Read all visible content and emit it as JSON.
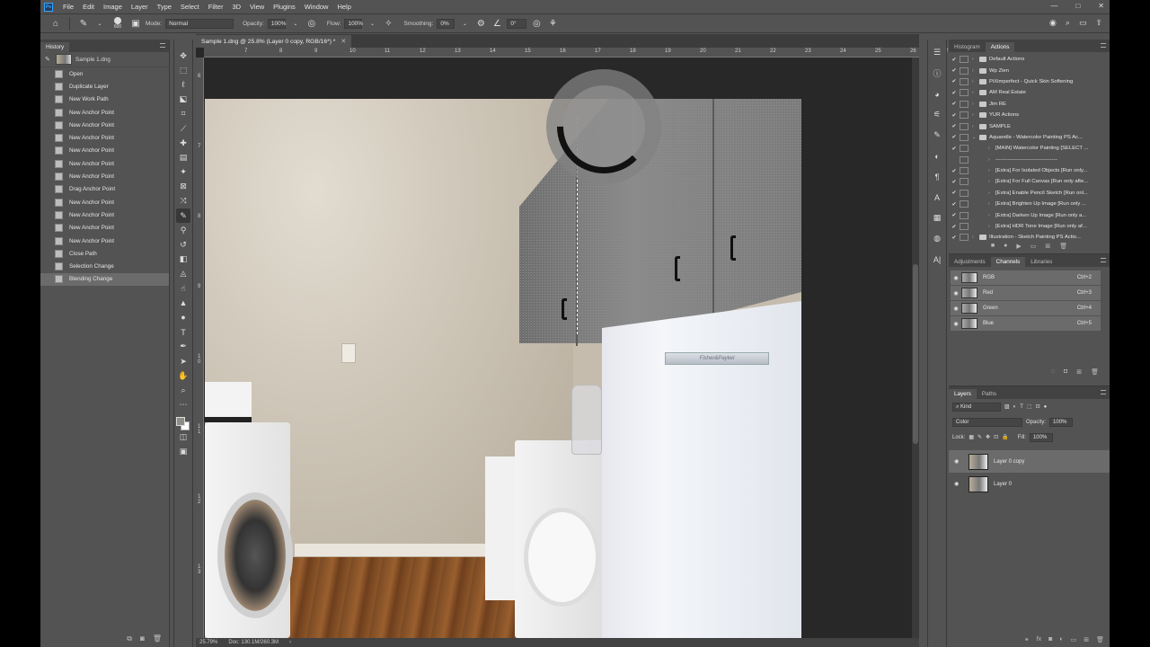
{
  "menubar": {
    "logo": "Ps",
    "items": [
      "File",
      "Edit",
      "Image",
      "Layer",
      "Type",
      "Select",
      "Filter",
      "3D",
      "View",
      "Plugins",
      "Window",
      "Help"
    ],
    "window_controls": [
      "—",
      "□",
      "✕"
    ]
  },
  "options": {
    "brush_size": "600",
    "mode_label": "Mode:",
    "mode_value": "Normal",
    "opacity_label": "Opacity:",
    "opacity_value": "100%",
    "flow_label": "Flow:",
    "flow_value": "100%",
    "smoothing_label": "Smoothing:",
    "smoothing_value": "0%",
    "angle_value": "0°"
  },
  "history": {
    "title": "History",
    "snapshot": "Sample 1.dng",
    "states": [
      "Open",
      "Duplicate Layer",
      "New Work Path",
      "New Anchor Point",
      "New Anchor Point",
      "New Anchor Point",
      "New Anchor Point",
      "New Anchor Point",
      "New Anchor Point",
      "Drag Anchor Point",
      "New Anchor Point",
      "New Anchor Point",
      "New Anchor Point",
      "New Anchor Point",
      "Close Path",
      "Selection Change",
      "Blending Change"
    ],
    "active_index": 16
  },
  "document": {
    "tab_title": "Sample 1.dng @ 25.8% (Layer 0 copy, RGB/16*) *",
    "zoom": "25.79%",
    "doc_size": "Doc: 130.1M/260.3M",
    "ruler_h": [
      "7",
      "8",
      "9",
      "10",
      "11",
      "12",
      "13",
      "14",
      "15",
      "16",
      "17",
      "18",
      "19",
      "20",
      "21",
      "22",
      "23",
      "24",
      "25",
      "26",
      "27"
    ],
    "ruler_v": [
      "6",
      "7",
      "8",
      "9",
      "1 0",
      "1 1",
      "1 2",
      "1 3"
    ],
    "fridge_badge": "Fisher&Paykel"
  },
  "actions": {
    "tabs": [
      "Histogram",
      "Actions"
    ],
    "active_tab": "Actions",
    "rows": [
      {
        "label": "Default Actions",
        "type": "set",
        "check": "✔"
      },
      {
        "label": "Wp Zien",
        "type": "set",
        "check": "✔"
      },
      {
        "label": "PiXimperfect - Quick Skin Softening",
        "type": "set",
        "check": "✔"
      },
      {
        "label": "AM Real Estate",
        "type": "set",
        "check": "✔"
      },
      {
        "label": "Jim RE",
        "type": "set",
        "check": "✔"
      },
      {
        "label": "YUR Actions",
        "type": "set",
        "check": "✔"
      },
      {
        "label": "SAMPLE",
        "type": "set",
        "check": "✔"
      },
      {
        "label": "Aquarelle - Watercolor Painting PS Ac...",
        "type": "set-open",
        "check": "✔"
      },
      {
        "label": "[MAIN] Watercolor Painting [SELECT ...",
        "type": "action",
        "check": "✔"
      },
      {
        "label": "-----------------------------------",
        "type": "action",
        "check": ""
      },
      {
        "label": "[Extra] For Isolated Objects [Run only...",
        "type": "action",
        "check": "✔"
      },
      {
        "label": "[Extra] For Full Canvas [Run only afte...",
        "type": "action",
        "check": "✔"
      },
      {
        "label": "[Extra] Enable Pencil Sketch [Run onl...",
        "type": "action",
        "check": "✔"
      },
      {
        "label": "[Extra] Brighten Up Image [Run only ...",
        "type": "action",
        "check": "✔"
      },
      {
        "label": "[Extra] Darken Up Image [Run only a...",
        "type": "action",
        "check": "✔"
      },
      {
        "label": "[Extra] HDR Tone Image [Run only af...",
        "type": "action",
        "check": "✔"
      },
      {
        "label": "Illustration - Sketch Painting PS Actio...",
        "type": "set",
        "check": "✔"
      }
    ]
  },
  "channels": {
    "tabs": [
      "Adjustments",
      "Channels",
      "Libraries"
    ],
    "active_tab": "Channels",
    "rows": [
      {
        "name": "RGB",
        "shortcut": "Ctrl+2"
      },
      {
        "name": "Red",
        "shortcut": "Ctrl+3"
      },
      {
        "name": "Green",
        "shortcut": "Ctrl+4"
      },
      {
        "name": "Blue",
        "shortcut": "Ctrl+5"
      }
    ]
  },
  "layers": {
    "tabs": [
      "Layers",
      "Paths"
    ],
    "active_tab": "Layers",
    "filter_value": "Kind",
    "blend_mode": "Color",
    "opacity_label": "Opacity:",
    "opacity_value": "100%",
    "lock_label": "Lock:",
    "fill_label": "Fill:",
    "fill_value": "100%",
    "items": [
      {
        "name": "Layer 0 copy",
        "selected": true
      },
      {
        "name": "Layer 0",
        "selected": false
      }
    ]
  }
}
